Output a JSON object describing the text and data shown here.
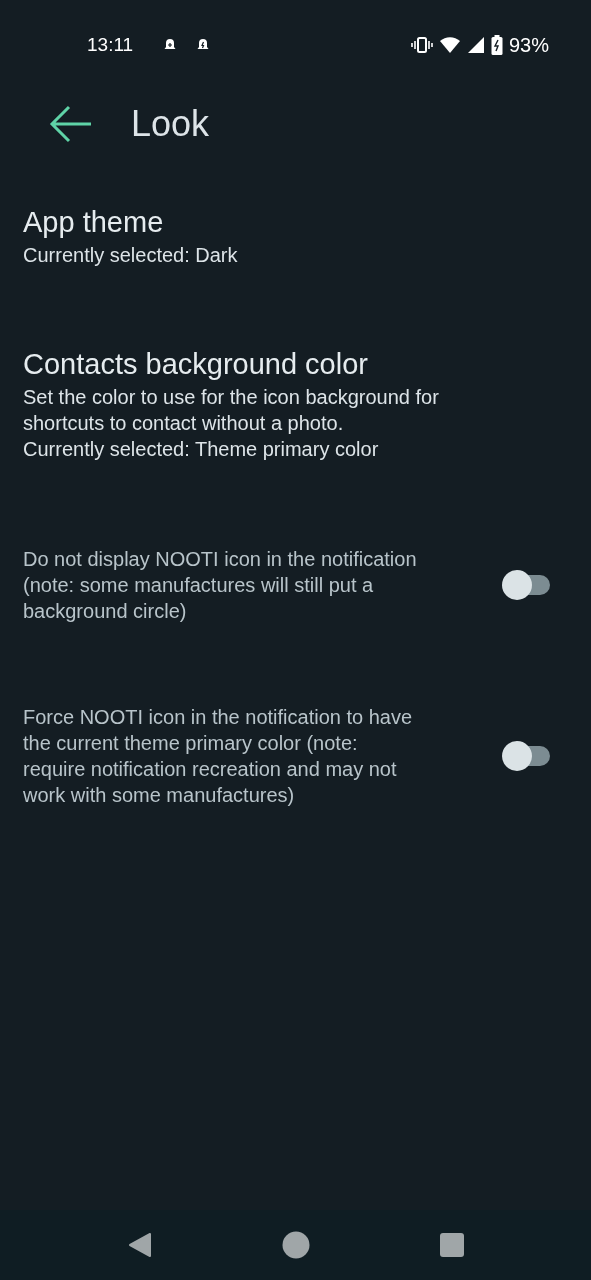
{
  "status_bar": {
    "time": "13:11",
    "battery": "93%"
  },
  "app_bar": {
    "title": "Look"
  },
  "preferences": [
    {
      "kind": "choice",
      "title": "App theme",
      "summary": "Currently selected: Dark"
    },
    {
      "kind": "choice",
      "title": "Contacts background color",
      "summary": "Set the color to use for the icon background for shortcuts to contact without a photo.\nCurrently selected: Theme primary color"
    },
    {
      "kind": "switch",
      "summary": "Do not display NOOTI icon in the notification (note: some manufactures will still put a background circle)",
      "on": false
    },
    {
      "kind": "switch",
      "summary": "Force NOOTI icon in the notification to have the current theme primary color (note: require notification recreation and may not work with some manufactures)",
      "on": false
    }
  ]
}
